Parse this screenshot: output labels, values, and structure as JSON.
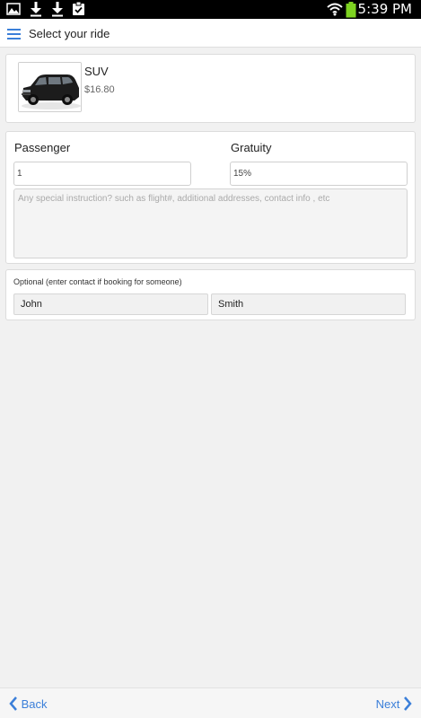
{
  "status_bar": {
    "time": "5:39 PM",
    "icons": [
      "image-icon",
      "download-icon",
      "download-icon",
      "clipboard-check-icon",
      "wifi-icon",
      "battery-icon"
    ],
    "battery_color": "#7ed321"
  },
  "header": {
    "title": "Select your ride",
    "menu_icon": "hamburger-menu-icon"
  },
  "ride": {
    "name": "SUV",
    "price": "$16.80",
    "image": "black-suv-photo"
  },
  "form": {
    "passenger_label": "Passenger",
    "passenger_value": "1",
    "gratuity_label": "Gratuity",
    "gratuity_value": "15%",
    "instructions_placeholder": "Any special instruction?  such as flight#, additional addresses, contact info , etc"
  },
  "contact": {
    "label": "Optional (enter contact if booking for someone)",
    "first_name": "John",
    "last_name": "Smith"
  },
  "nav": {
    "back_label": "Back",
    "next_label": "Next"
  },
  "colors": {
    "accent": "#3b7fd9",
    "background": "#f1f1f1"
  }
}
